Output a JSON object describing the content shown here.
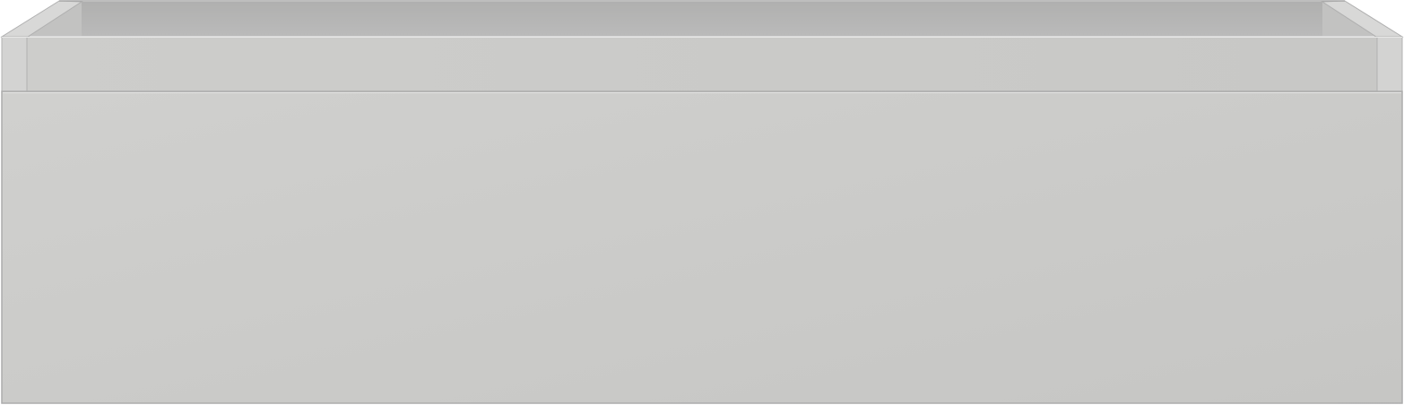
{
  "object": {
    "kind": "open-drawer-box",
    "colors": {
      "front_panel": "#cbcbc9",
      "front_panel_light": "#d0d0ce",
      "front_panel_dark": "#c7c7c5",
      "inner_back_wall": "#b4b4b3",
      "inner_side_wall": "#c4c4c3",
      "rim_top": "#d6d6d5",
      "edge_line": "#a9a9a9",
      "highlight": "#e6e6e5"
    }
  }
}
